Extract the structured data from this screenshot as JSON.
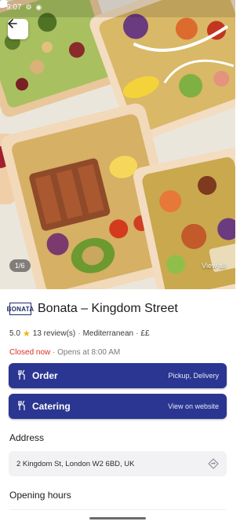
{
  "status_bar": {
    "time": "9:07",
    "left_icons": [
      "settings-icon",
      "shield-icon"
    ],
    "right_icons": [
      "wifi-icon",
      "signal-icon",
      "battery-icon"
    ]
  },
  "hero": {
    "photo_counter": "1/6",
    "view_all": "View all"
  },
  "restaurant": {
    "logo_text": "BONATA",
    "name": "Bonata – Kingdom Street",
    "rating": "5.0",
    "reviews": "13 review(s)",
    "cuisine": "Mediterranean",
    "price": "££",
    "status": "Closed now",
    "opens": "Opens at 8:00 AM"
  },
  "actions": {
    "order": {
      "label": "Order",
      "sub": "Pickup, Delivery",
      "icon": "cutlery-icon"
    },
    "catering": {
      "label": "Catering",
      "sub": "View on website",
      "icon": "cutlery-icon"
    }
  },
  "address": {
    "heading": "Address",
    "value": "2 Kingdom St, London W2 6BD, UK"
  },
  "opening_hours": {
    "heading": "Opening hours"
  },
  "colors": {
    "primary": "#2a3691",
    "closed": "#d93025",
    "star": "#f4b400"
  }
}
